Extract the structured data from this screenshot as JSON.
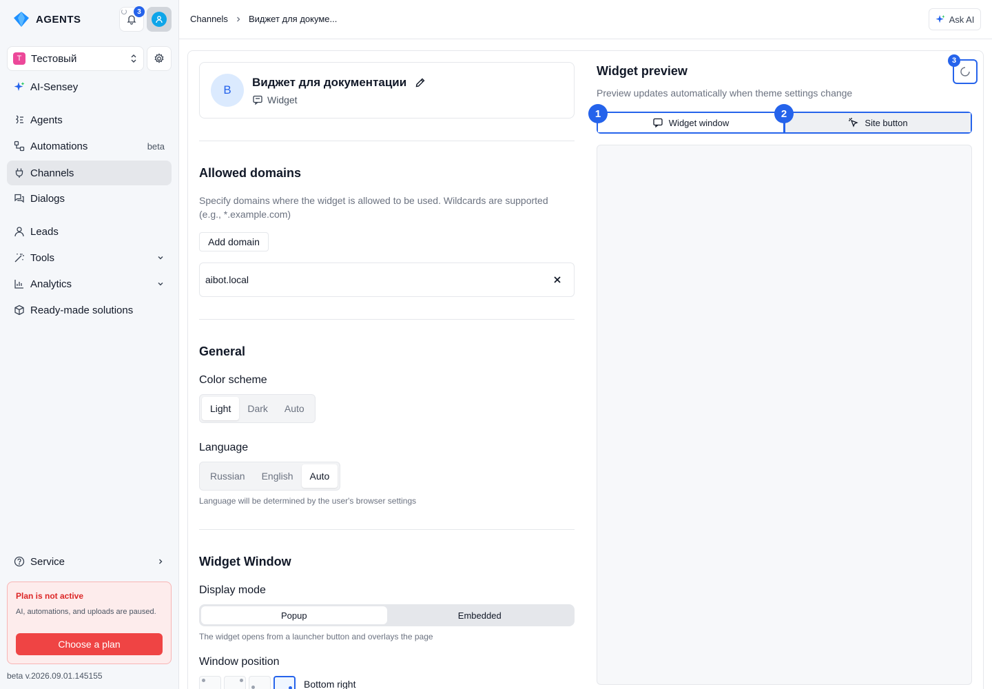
{
  "app": {
    "logo_text": "AGENTS",
    "notifications_count": "3",
    "brand_color": "#2563eb"
  },
  "workspace": {
    "badge": "T",
    "name": "Тестовый"
  },
  "sidebar": {
    "items": [
      {
        "label": "AI-Sensey",
        "icon": "sparkle-icon"
      },
      {
        "label": "Agents",
        "icon": "agent-icon"
      },
      {
        "label": "Automations",
        "icon": "automation-icon",
        "tag": "beta"
      },
      {
        "label": "Channels",
        "icon": "plug-icon",
        "active": true
      },
      {
        "label": "Dialogs",
        "icon": "chat-icon"
      },
      {
        "label": "Leads",
        "icon": "user-icon"
      },
      {
        "label": "Tools",
        "icon": "wand-icon"
      },
      {
        "label": "Analytics",
        "icon": "chart-icon"
      },
      {
        "label": "Ready-made solutions",
        "icon": "box-icon"
      }
    ],
    "service_label": "Service",
    "plan": {
      "title": "Plan is not active",
      "desc": "AI, automations, and uploads are paused.",
      "button": "Choose a plan"
    },
    "version": "beta v.2026.09.01.145155"
  },
  "header": {
    "breadcrumb": [
      "Channels",
      "Виджет для докуме..."
    ],
    "ask_ai": "Ask AI"
  },
  "channel": {
    "avatar_letter": "В",
    "name": "Виджет для документации",
    "type": "Widget"
  },
  "allowed_domains": {
    "title": "Allowed domains",
    "desc": "Specify domains where the widget is allowed to be used. Wildcards are supported (e.g., *.example.com)",
    "add_button": "Add domain",
    "domains": [
      "aibot.local"
    ]
  },
  "general": {
    "title": "General",
    "color_scheme_label": "Color scheme",
    "color_scheme_options": [
      "Light",
      "Dark",
      "Auto"
    ],
    "color_scheme_selected": "Light",
    "language_label": "Language",
    "language_options": [
      "Russian",
      "English",
      "Auto"
    ],
    "language_selected": "Auto",
    "language_hint": "Language will be determined by the user's browser settings"
  },
  "widget_window": {
    "title": "Widget Window",
    "display_mode_label": "Display mode",
    "display_mode_options": [
      "Popup",
      "Embedded"
    ],
    "display_mode_selected": "Popup",
    "display_mode_hint": "The widget opens from a launcher button and overlays the page",
    "position_label": "Window position",
    "position_selected": "Bottom right"
  },
  "preview": {
    "title": "Widget preview",
    "subtitle": "Preview updates automatically when theme settings change",
    "tabs": [
      "Widget window",
      "Site button"
    ],
    "selected_tab": "Widget window",
    "markers": [
      "1",
      "2",
      "3"
    ]
  }
}
